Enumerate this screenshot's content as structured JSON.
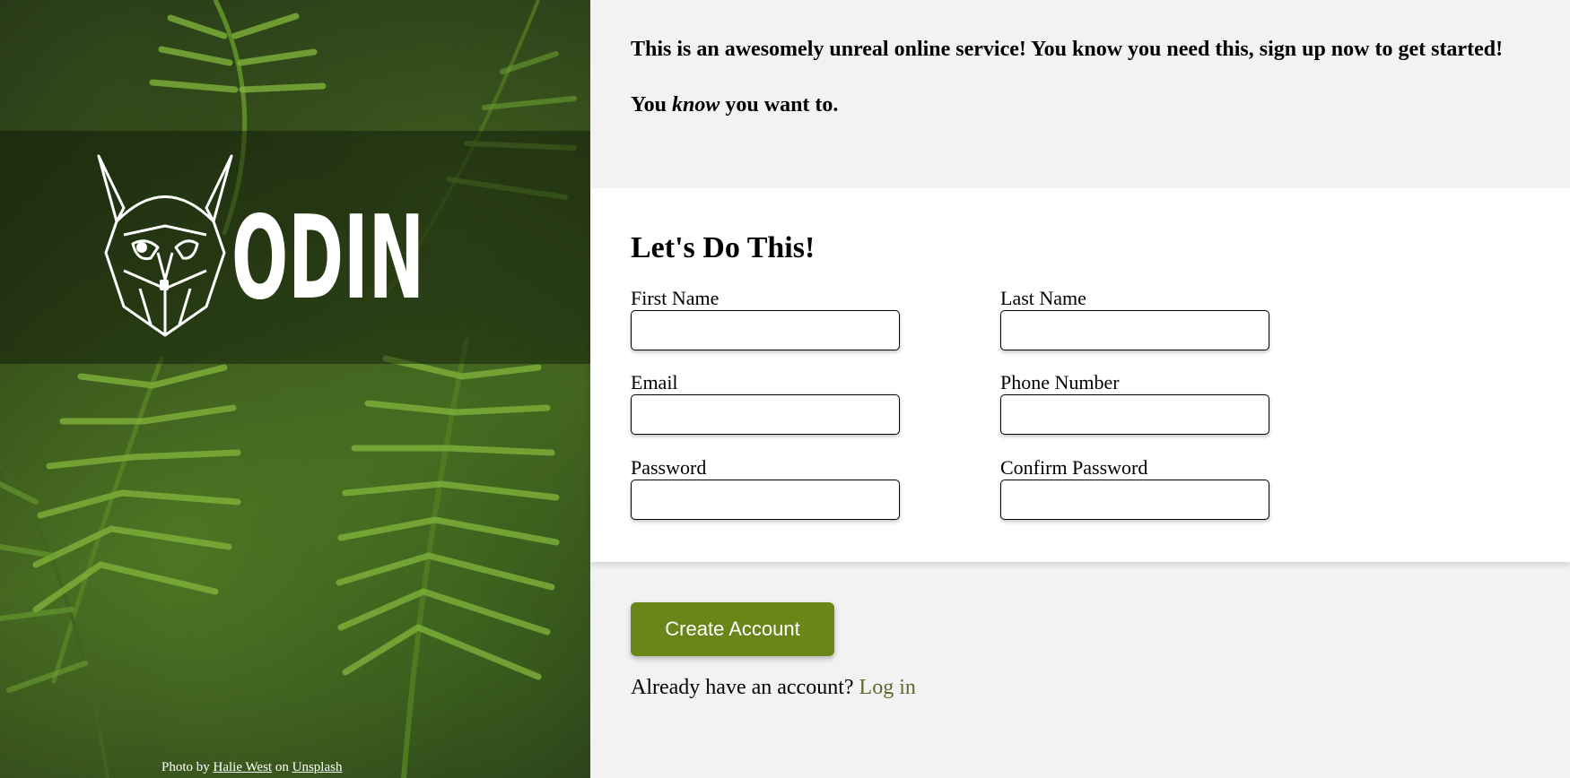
{
  "sidebar": {
    "logo_text": "ODIN",
    "credit": {
      "prefix": "Photo by",
      "author": "Halie West",
      "middle": "on",
      "site": "Unsplash"
    }
  },
  "intro": {
    "line1": "This is an awesomely unreal online service! You know you need this, sign up now to get started!",
    "line2_pre": "You",
    "line2_em": "know",
    "line2_post": "you want to."
  },
  "form": {
    "title": "Let's Do This!",
    "fields": {
      "first_name": {
        "label": "First Name",
        "value": ""
      },
      "last_name": {
        "label": "Last Name",
        "value": ""
      },
      "email": {
        "label": "Email",
        "value": ""
      },
      "phone": {
        "label": "Phone Number",
        "value": ""
      },
      "password": {
        "label": "Password",
        "value": ""
      },
      "confirm_password": {
        "label": "Confirm Password",
        "value": ""
      }
    }
  },
  "actions": {
    "create_label": "Create Account",
    "login_prompt": "Already have an account?",
    "login_link": "Log in"
  },
  "colors": {
    "accent": "#6a8618",
    "link": "#596b2c",
    "page_bg": "#f2f2f2",
    "panel_bg": "#ffffff"
  }
}
